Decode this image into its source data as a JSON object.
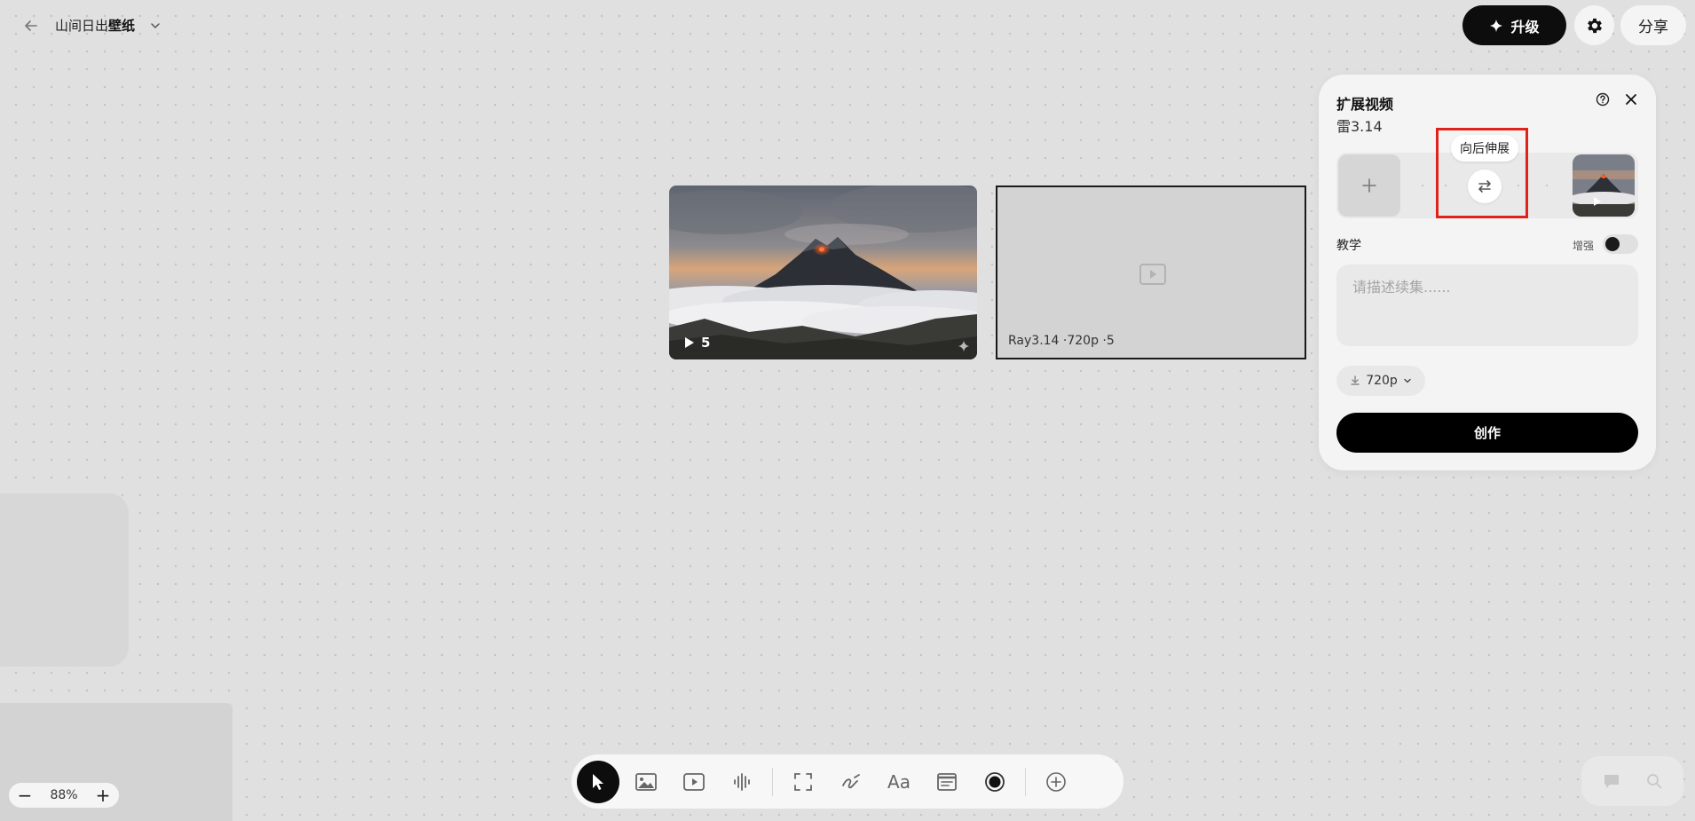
{
  "header": {
    "project_title_part1": "山间日出",
    "project_title_part2": "壁纸",
    "upgrade_label": "升级",
    "share_label": "分享"
  },
  "canvas": {
    "image_card": {
      "play_count": "5"
    },
    "placeholder_card": {
      "meta": "Ray3.14 ·720p ·5"
    }
  },
  "zoom": {
    "level": "88%",
    "minus": "−",
    "plus": "+"
  },
  "toolbar": {
    "tools": [
      "select-icon",
      "image-icon",
      "video-icon",
      "audio-icon",
      "frame-icon",
      "draw-icon",
      "text-icon",
      "note-icon",
      "record-icon",
      "add-icon"
    ],
    "text_tool_label": "Aa",
    "active_tool": "select"
  },
  "panel": {
    "title": "扩展视频",
    "subtitle": "雷3.14",
    "tooltip": "向后伸展",
    "teach_label": "教学",
    "enhance_label": "增强",
    "prompt_placeholder": "请描述续集......",
    "resolution": "720p",
    "create_label": "创作"
  },
  "colors": {
    "accent_dark": "#0d0d0d",
    "highlight_red": "#e0221c",
    "canvas_bg": "#e0e0e0"
  }
}
